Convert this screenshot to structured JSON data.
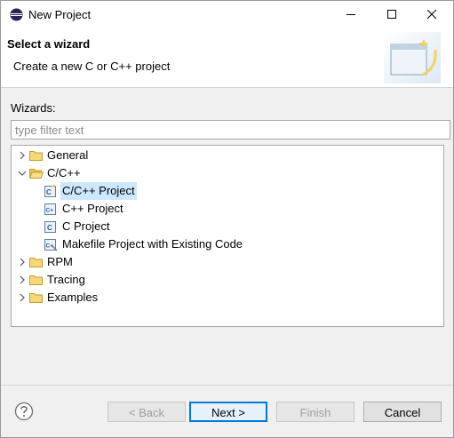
{
  "window": {
    "title": "New Project",
    "icon": "eclipse-icon",
    "controls": [
      "minimize-icon",
      "maximize-icon",
      "close-icon"
    ]
  },
  "banner": {
    "title": "Select a wizard",
    "description": "Create a new C or C++ project",
    "image": "wizard-banner-icon"
  },
  "wizards": {
    "label": "Wizards:",
    "filter_placeholder": "type filter text",
    "filter_value": "",
    "tree": [
      {
        "label": "General",
        "expanded": false,
        "icon": "folder-icon"
      },
      {
        "label": "C/C++",
        "expanded": true,
        "icon": "folder-open-icon",
        "children": [
          {
            "label": "C/C++ Project",
            "selected": true,
            "icon": "cproject-icon"
          },
          {
            "label": "C++ Project",
            "icon": "cppproject-icon"
          },
          {
            "label": "C Project",
            "icon": "cproject-icon"
          },
          {
            "label": "Makefile Project with Existing Code",
            "icon": "makefile-project-icon"
          }
        ]
      },
      {
        "label": "RPM",
        "expanded": false,
        "icon": "folder-icon"
      },
      {
        "label": "Tracing",
        "expanded": false,
        "icon": "folder-icon"
      },
      {
        "label": "Examples",
        "expanded": false,
        "icon": "folder-icon"
      }
    ]
  },
  "buttons": {
    "help": "help-icon",
    "back": "< Back",
    "next": "Next >",
    "finish": "Finish",
    "cancel": "Cancel"
  },
  "colors": {
    "selection": "#cce8ff",
    "default_button_border": "#0078d7",
    "folder": "#e8b84a"
  }
}
